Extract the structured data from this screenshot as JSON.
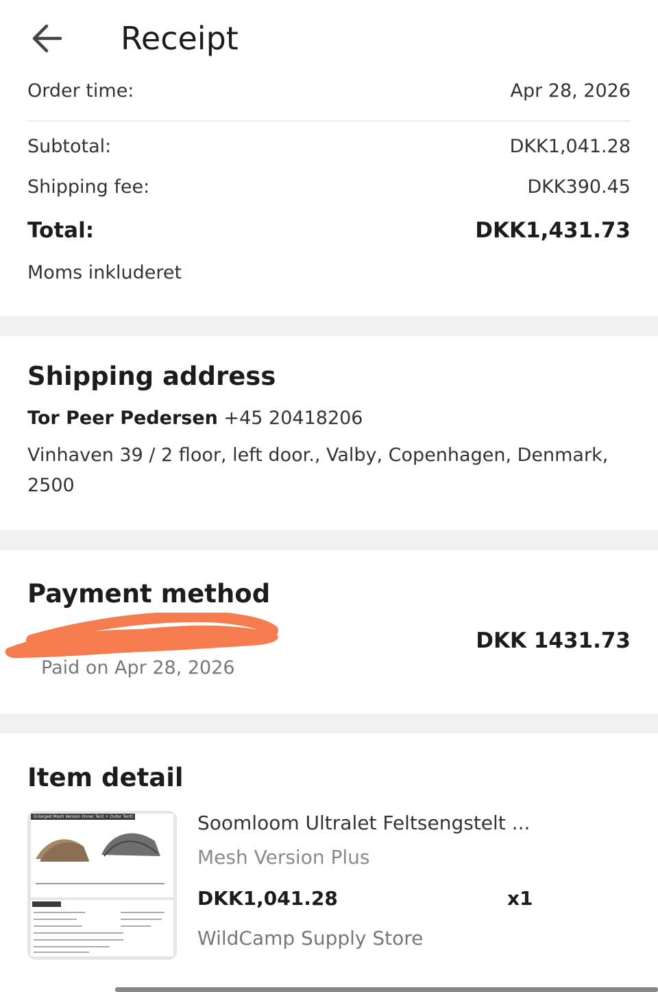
{
  "header": {
    "back_icon": "arrow-left-icon",
    "title": "Receipt"
  },
  "order": {
    "order_time_label": "Order time:",
    "order_time_value": "Apr 28, 2026",
    "subtotal_label": "Subtotal:",
    "subtotal_value": "DKK1,041.28",
    "shipping_label": "Shipping fee:",
    "shipping_value": "DKK390.45",
    "total_label": "Total:",
    "total_value": "DKK1,431.73",
    "vat_note": "Moms inkluderet"
  },
  "shipping": {
    "title": "Shipping address",
    "name": "Tor Peer Pedersen",
    "phone": "+45 20418206",
    "address_line1": "Vinhaven 39 / 2 floor, left door., Valby, Copenhagen, Denmark,",
    "address_line2": "2500"
  },
  "payment": {
    "title": "Payment method",
    "amount": "DKK 1431.73",
    "paid_on": "Paid on Apr 28, 2026",
    "redaction_color": "#f47c4f"
  },
  "item": {
    "title": "Item detail",
    "thumb_header": "Enlarged Mesh Version (Inner Tent + Outer Tent)",
    "name": "Soomloom Ultralet Feltsengstelt ...",
    "variant": "Mesh Version Plus",
    "price": "DKK1,041.28",
    "quantity": "x1",
    "store": "WildCamp Supply Store"
  }
}
